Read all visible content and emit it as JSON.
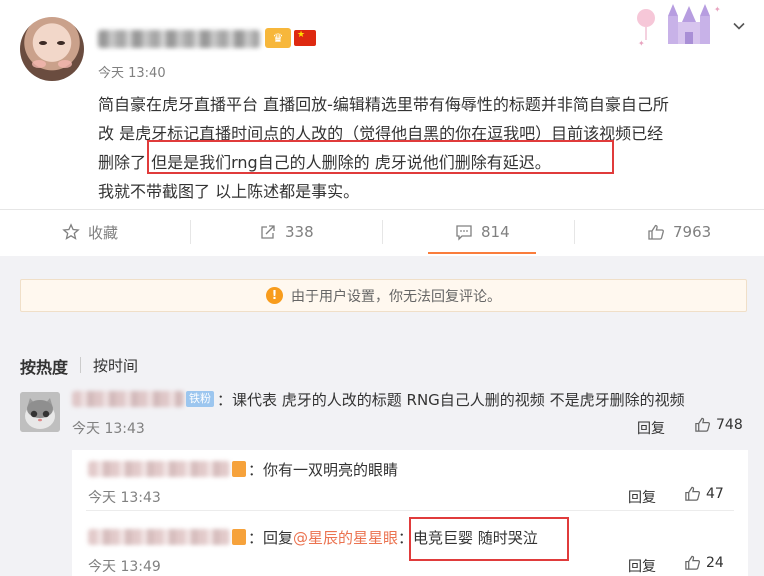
{
  "post": {
    "time": "今天 13:40",
    "lines": [
      "简自豪在虎牙直播平台 直播回放-编辑精选里带有侮辱性的标题并非简自豪自己所",
      "改 是虎牙标记直播时间点的人改的（觉得他自黑的你在逗我吧）目前该视频已经",
      "删除了 但是是我们rng自己的人删除的  虎牙说他们删除有延迟。",
      "我就不带截图了 以上陈述都是事实。"
    ]
  },
  "actions": {
    "favorite": "收藏",
    "repost": "338",
    "comment": "814",
    "like": "7963"
  },
  "notice": "由于用户设置，你无法回复评论。",
  "sort": {
    "hot": "按热度",
    "time": "按时间"
  },
  "comments": [
    {
      "badge": "铁粉",
      "text": "：课代表 虎牙的人改的标题 RNG自己人删的视频 不是虎牙删除的视频",
      "time": "今天 13:43",
      "reply": "回复",
      "likes": "748"
    }
  ],
  "replies": [
    {
      "text": "：你有一双明亮的眼睛",
      "time": "今天 13:43",
      "reply": "回复",
      "likes": "47"
    },
    {
      "prefix": "：回复",
      "mention": "@星辰的星星眼",
      "suffix": "：电竞巨婴 随时哭泣",
      "time": "今天 13:49",
      "reply": "回复",
      "likes": "24"
    }
  ],
  "colors": {
    "accent": "#fa7d3c",
    "highlight_box": "#e03b3b",
    "mention": "#eb7350",
    "notice_bg": "#fff8ef"
  }
}
